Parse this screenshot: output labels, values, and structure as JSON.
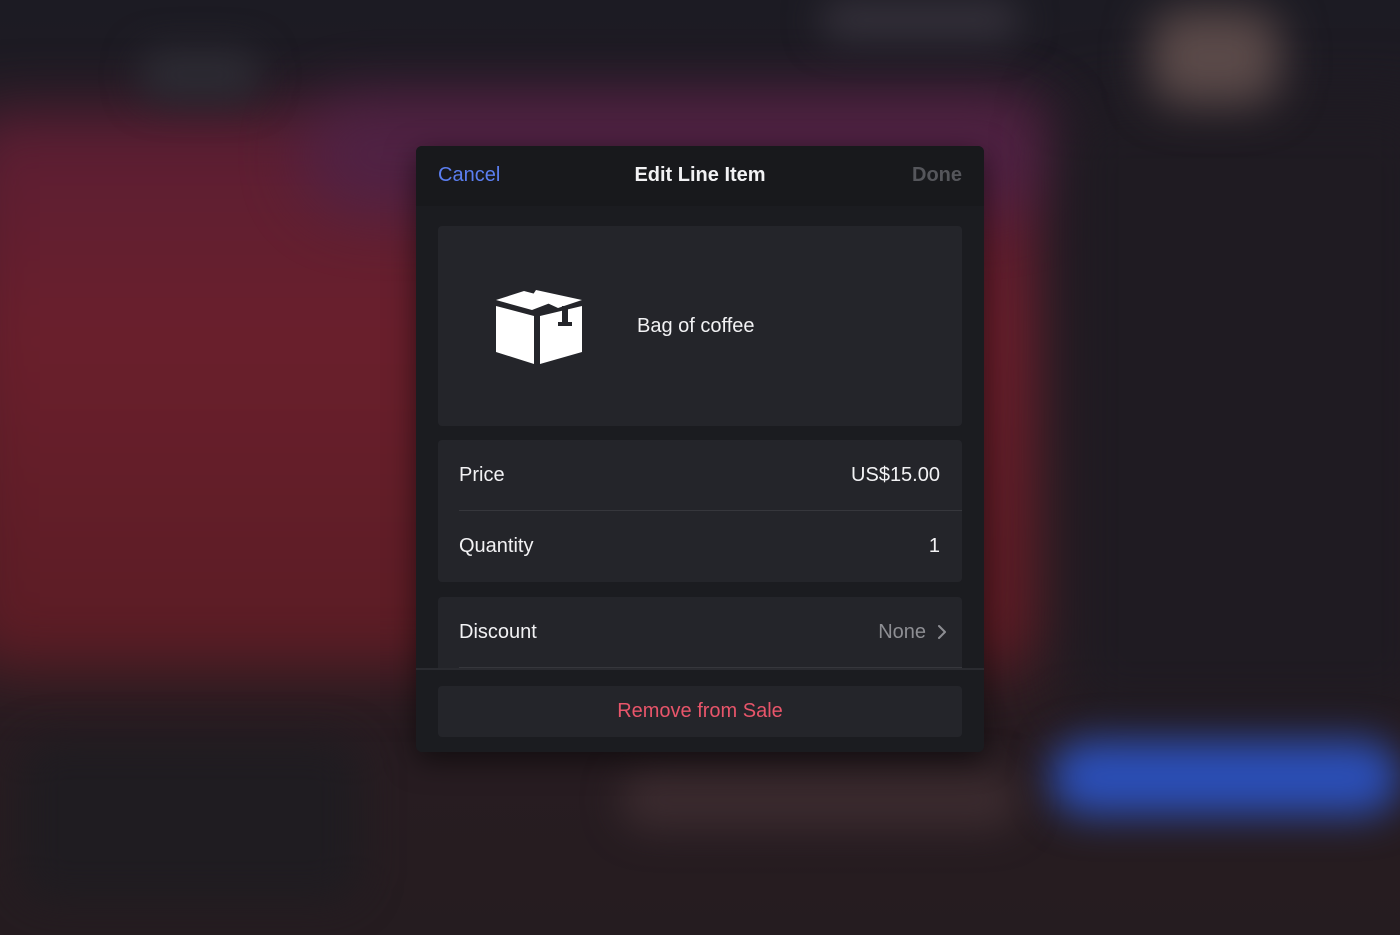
{
  "header": {
    "cancel_label": "Cancel",
    "title": "Edit Line Item",
    "done_label": "Done"
  },
  "item": {
    "icon": "box-icon",
    "name": "Bag of coffee"
  },
  "fields": {
    "price": {
      "label": "Price",
      "value": "US$15.00"
    },
    "quantity": {
      "label": "Quantity",
      "value": "1"
    },
    "discount": {
      "label": "Discount",
      "value": "None",
      "icon": "chevron-right-icon"
    }
  },
  "footer": {
    "remove_label": "Remove from Sale"
  },
  "colors": {
    "accent": "#5b7ef0",
    "destructive": "#e8556a",
    "disabled": "#55565b"
  }
}
